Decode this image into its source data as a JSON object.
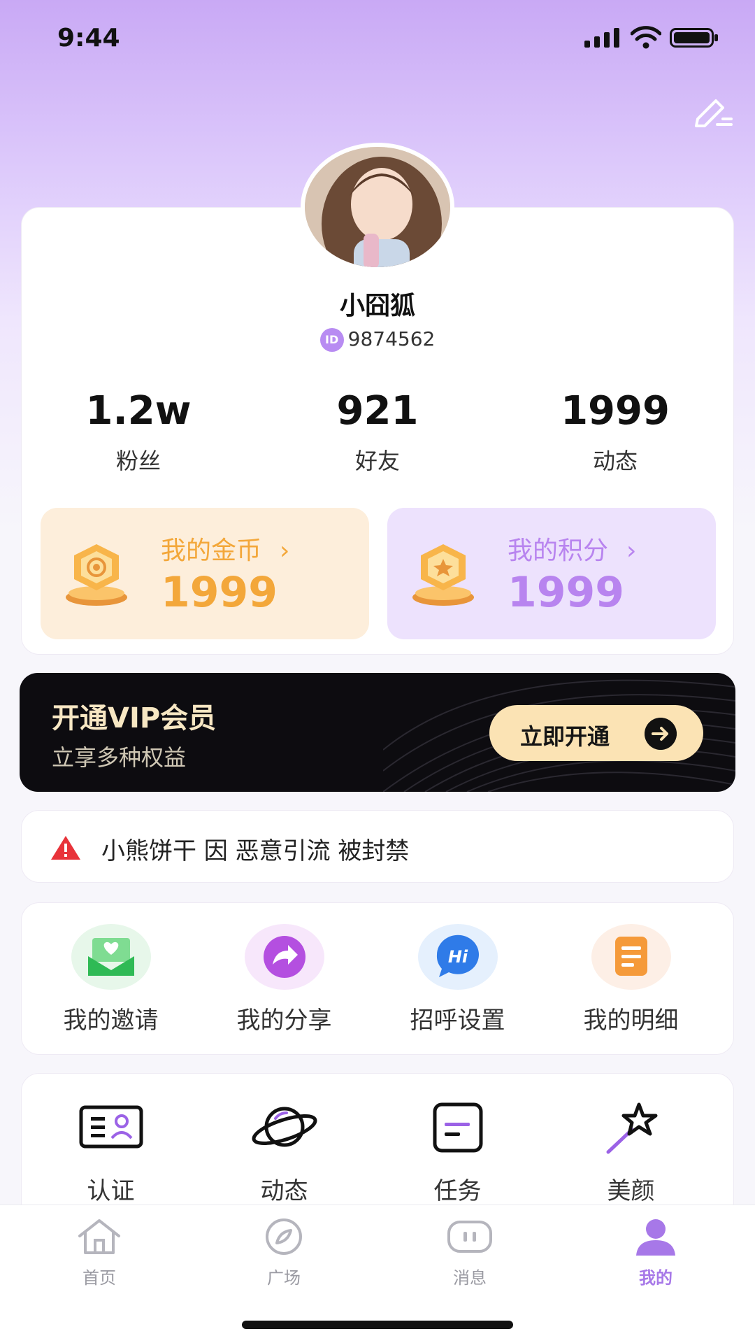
{
  "status_bar": {
    "time": "9:44"
  },
  "profile": {
    "nickname": "小囧狐",
    "id_badge": "ID",
    "id": "9874562",
    "stats": [
      {
        "value": "1.2w",
        "label": "粉丝"
      },
      {
        "value": "921",
        "label": "好友"
      },
      {
        "value": "1999",
        "label": "动态"
      }
    ]
  },
  "wallet": {
    "coins": {
      "title": "我的金币",
      "value": "1999",
      "icon": "gold-coin-icon"
    },
    "points": {
      "title": "我的积分",
      "value": "1999",
      "icon": "star-coin-icon"
    }
  },
  "vip": {
    "title": "开通VIP会员",
    "subtitle": "立享多种权益",
    "button": "立即开通"
  },
  "notice": {
    "text": "小熊饼干 因 恶意引流 被封禁"
  },
  "quick_actions": [
    {
      "label": "我的邀请",
      "icon": "invite-icon"
    },
    {
      "label": "我的分享",
      "icon": "share-icon"
    },
    {
      "label": "招呼设置",
      "icon": "greeting-icon"
    },
    {
      "label": "我的明细",
      "icon": "details-icon"
    }
  ],
  "tools": [
    {
      "label": "认证",
      "icon": "id-card-icon"
    },
    {
      "label": "动态",
      "icon": "planet-icon"
    },
    {
      "label": "任务",
      "icon": "task-icon"
    },
    {
      "label": "美颜",
      "icon": "magic-wand-icon"
    }
  ],
  "tabbar": [
    {
      "label": "首页",
      "icon": "home-icon"
    },
    {
      "label": "广场",
      "icon": "compass-icon"
    },
    {
      "label": "消息",
      "icon": "message-icon"
    },
    {
      "label": "我的",
      "icon": "user-icon",
      "active": true
    }
  ],
  "colors": {
    "accent": "#a778e8",
    "gold": "#f3a73a",
    "vip_gold": "#fbe3b4",
    "warn": "#e8333a"
  }
}
